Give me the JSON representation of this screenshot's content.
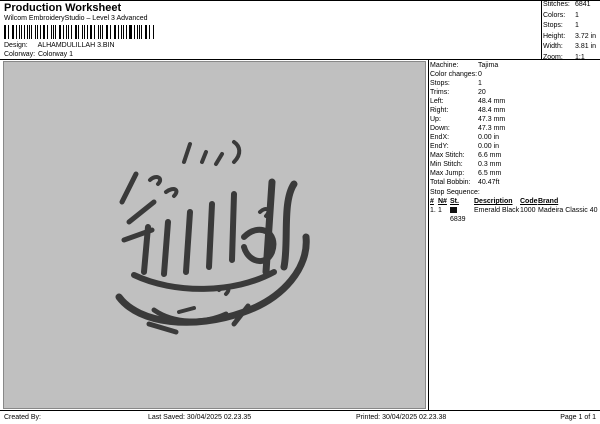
{
  "header": {
    "title": "Production Worksheet",
    "subtitle": "Wilcom EmbroideryStudio – Level 3 Advanced",
    "design_label": "Design:",
    "design_value": "ALHAMDULILLAH 3.BIN",
    "colorway_label": "Colorway:",
    "colorway_value": "Colorway 1"
  },
  "stats": [
    {
      "k": "Stitches:",
      "v": "6841"
    },
    {
      "k": "Colors:",
      "v": "1"
    },
    {
      "k": "Stops:",
      "v": "1"
    },
    {
      "k": "Height:",
      "v": "3.72 in"
    },
    {
      "k": "Width:",
      "v": "3.81 in"
    },
    {
      "k": "Zoom:",
      "v": "1:1"
    }
  ],
  "info": [
    {
      "k": "Machine:",
      "v": "Tajima"
    },
    {
      "k": "Color changes:",
      "v": "0"
    },
    {
      "k": "Stops:",
      "v": "1"
    },
    {
      "k": "Trims:",
      "v": "20"
    },
    {
      "k": "Left:",
      "v": "48.4 mm"
    },
    {
      "k": "Right:",
      "v": "48.4 mm"
    },
    {
      "k": "Up:",
      "v": "47.3 mm"
    },
    {
      "k": "Down:",
      "v": "47.3 mm"
    },
    {
      "k": "EndX:",
      "v": "0.00 in"
    },
    {
      "k": "EndY:",
      "v": "0.00 in"
    },
    {
      "k": "Max Stitch:",
      "v": "6.6 mm"
    },
    {
      "k": "Min Stitch:",
      "v": "0.3 mm"
    },
    {
      "k": "Max Jump:",
      "v": "6.5 mm"
    },
    {
      "k": "Total Bobbin:",
      "v": "40.47ft"
    }
  ],
  "stop_sequence": {
    "title": "Stop Sequence:",
    "headers": {
      "n": "#",
      "no": "N#",
      "st": "St.",
      "desc": "Description",
      "code": "Code",
      "brand": "Brand"
    },
    "rows": [
      {
        "n": "1.",
        "no": "1",
        "st": "6839",
        "desc": "Emerald Black",
        "code": "1000",
        "brand": "Madeira Classic 40"
      }
    ]
  },
  "footer": {
    "created_by": "Created By:",
    "last_saved": "Last Saved: 30/04/2025 02.23.35",
    "printed": "Printed: 30/04/2025 02.23.38",
    "page": "Page 1 of 1"
  },
  "colors": {
    "canvas_bg": "#c0c0c0",
    "thread": "#3a3a3a"
  }
}
